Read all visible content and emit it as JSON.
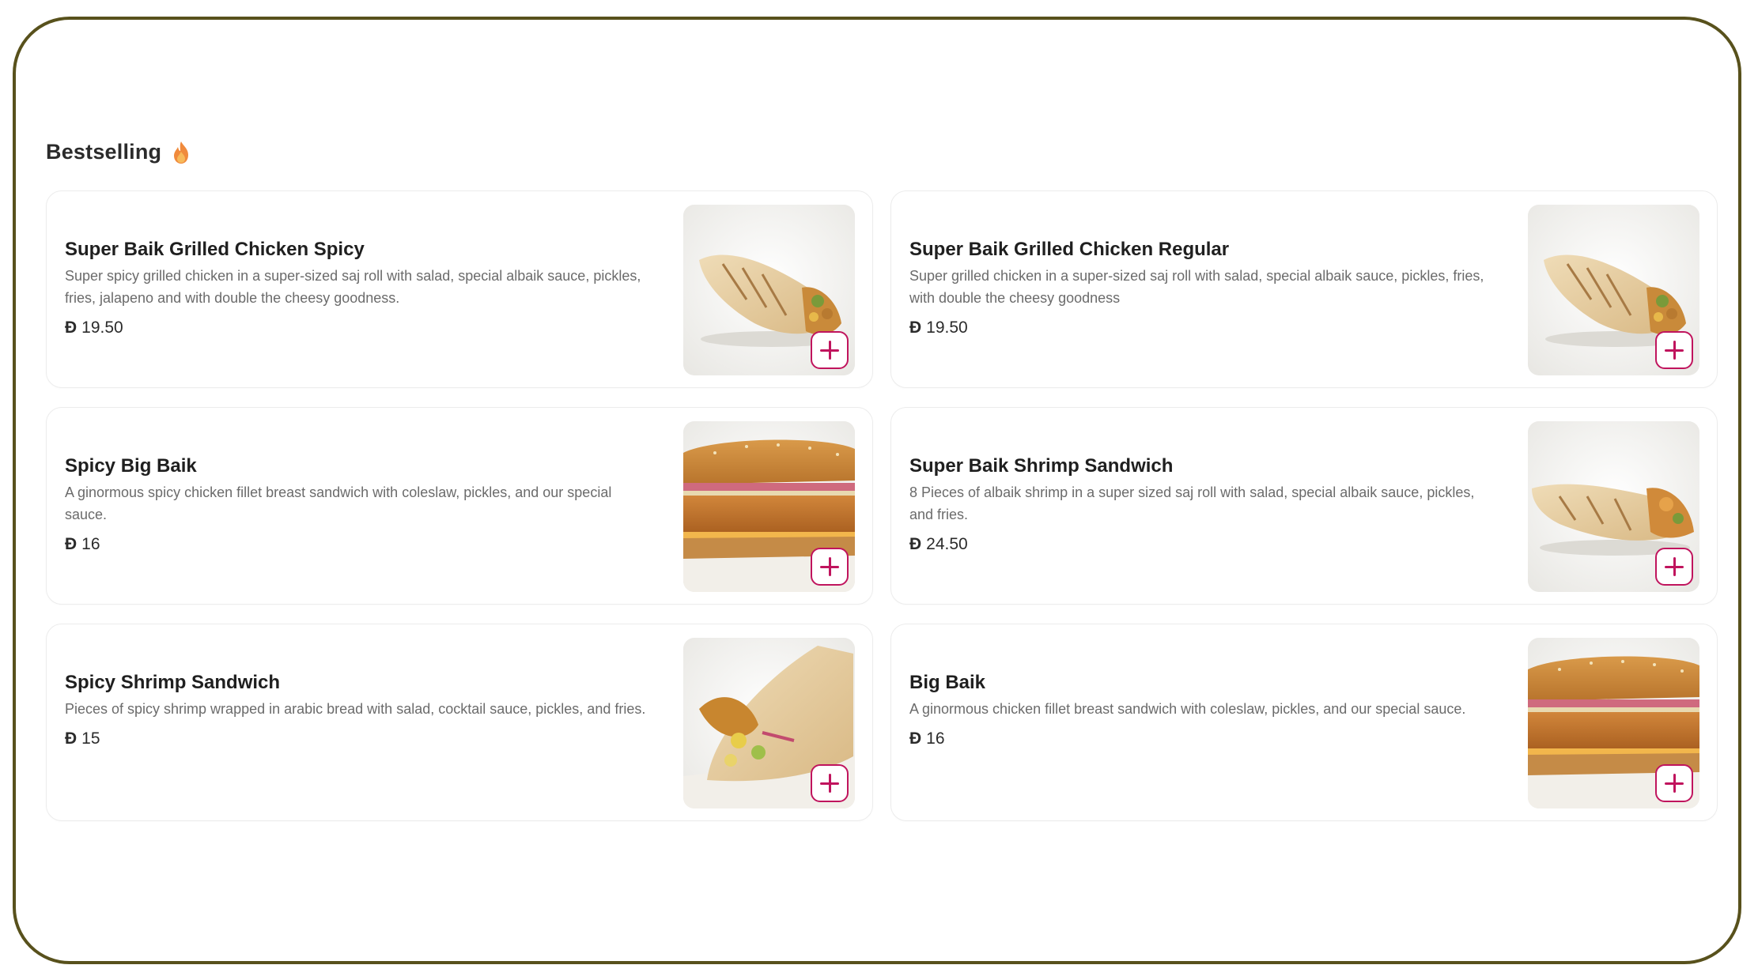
{
  "section": {
    "title": "Bestselling",
    "icon": "flame-icon"
  },
  "accent_color": "#c0145d",
  "currency_symbol": "Ð",
  "items": [
    {
      "name": "Super Baik Grilled Chicken Spicy",
      "description": "Super spicy grilled chicken in a super-sized saj roll with salad, special albaik sauce, pickles, fries, jalapeno and with double the cheesy goodness.",
      "price": "19.50",
      "image": "grilled-chicken-wrap-image"
    },
    {
      "name": "Super Baik Grilled Chicken Regular",
      "description": "Super grilled chicken in a super-sized saj roll with salad, special albaik sauce, pickles, fries, with double the cheesy goodness",
      "price": "19.50",
      "image": "grilled-chicken-wrap-image"
    },
    {
      "name": "Spicy Big Baik",
      "description": "A ginormous spicy chicken fillet breast sandwich with coleslaw, pickles, and our special sauce.",
      "price": "16",
      "image": "chicken-fillet-sandwich-image"
    },
    {
      "name": "Super Baik Shrimp Sandwich",
      "description": "8 Pieces of albaik shrimp in a super sized saj roll with salad, special albaik sauce, pickles, and fries.",
      "price": "24.50",
      "image": "shrimp-saj-roll-image"
    },
    {
      "name": "Spicy Shrimp Sandwich",
      "description": "Pieces of spicy shrimp wrapped in arabic bread with salad, cocktail sauce, pickles, and fries.",
      "price": "15",
      "image": "shrimp-wrap-image"
    },
    {
      "name": "Big Baik",
      "description": "A ginormous chicken fillet breast sandwich with coleslaw, pickles, and our special sauce.",
      "price": "16",
      "image": "chicken-fillet-sandwich-image"
    }
  ]
}
